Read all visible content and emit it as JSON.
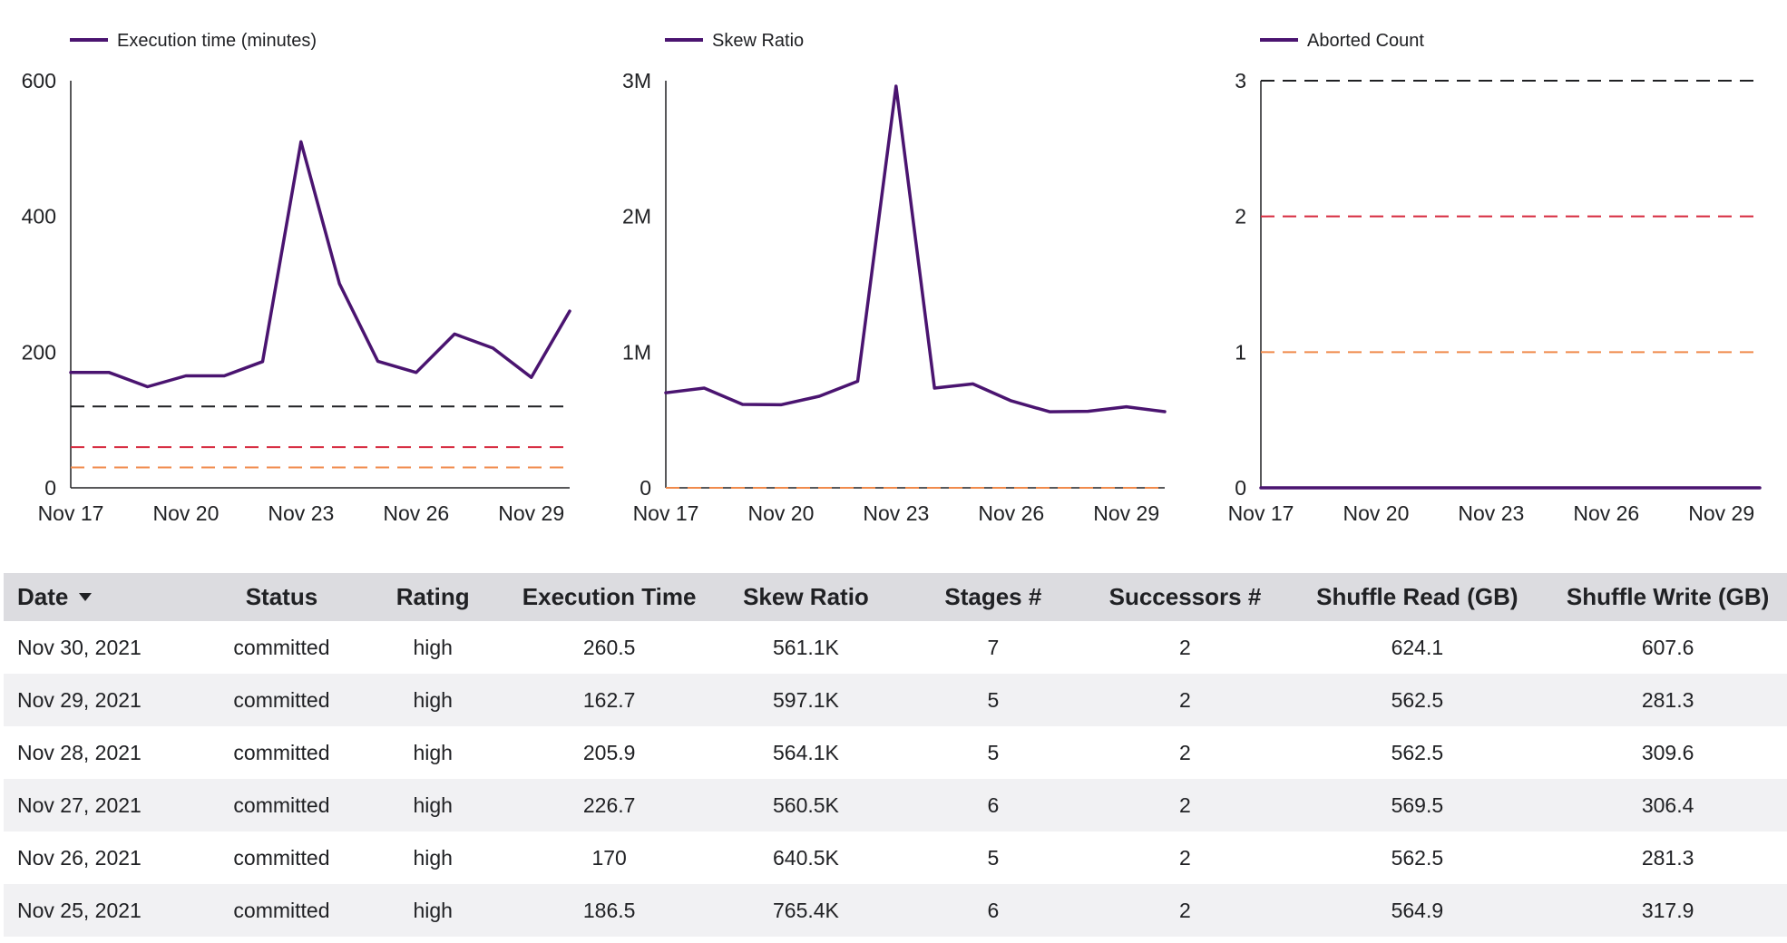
{
  "colors": {
    "series": "#4a1470",
    "line_black": "#202124",
    "line_red": "#d6293e",
    "line_orange": "#f08a4b",
    "axis": "#202124",
    "header_bg": "#dcdce0",
    "row_alt_bg": "#f1f1f3"
  },
  "chart_data": [
    {
      "type": "line",
      "legend": "Execution time (minutes)",
      "x": [
        "Nov 17",
        "Nov 18",
        "Nov 19",
        "Nov 20",
        "Nov 21",
        "Nov 22",
        "Nov 23",
        "Nov 24",
        "Nov 25",
        "Nov 26",
        "Nov 27",
        "Nov 28",
        "Nov 29",
        "Nov 30"
      ],
      "x_tick_labels": [
        "Nov 17",
        "Nov 20",
        "Nov 23",
        "Nov 26",
        "Nov 29"
      ],
      "series": [
        {
          "name": "Execution time (minutes)",
          "values": [
            170,
            170,
            149,
            165,
            165,
            186,
            510,
            301,
            186.5,
            170,
            226.7,
            205.9,
            162.7,
            260.5
          ]
        }
      ],
      "reference_lines": [
        {
          "value": 120,
          "color": "black",
          "style": "dashed"
        },
        {
          "value": 60,
          "color": "red",
          "style": "dashed"
        },
        {
          "value": 30,
          "color": "orange",
          "style": "dashed"
        }
      ],
      "y_ticks": [
        "0",
        "200",
        "400",
        "600"
      ],
      "ylim": [
        0,
        600
      ],
      "legend_position": "top-left"
    },
    {
      "type": "line",
      "legend": "Skew Ratio",
      "x": [
        "Nov 17",
        "Nov 18",
        "Nov 19",
        "Nov 20",
        "Nov 21",
        "Nov 22",
        "Nov 23",
        "Nov 24",
        "Nov 25",
        "Nov 26",
        "Nov 27",
        "Nov 28",
        "Nov 29",
        "Nov 30"
      ],
      "x_tick_labels": [
        "Nov 17",
        "Nov 20",
        "Nov 23",
        "Nov 26",
        "Nov 29"
      ],
      "series": [
        {
          "name": "Skew Ratio",
          "values": [
            700000,
            735000,
            615000,
            612000,
            675000,
            785000,
            2960000,
            735000,
            765400,
            640500,
            560500,
            564100,
            597100,
            561100
          ]
        }
      ],
      "reference_lines": [
        {
          "value": 0,
          "color": "orange",
          "style": "dashed"
        }
      ],
      "y_ticks": [
        "0",
        "1M",
        "2M",
        "3M"
      ],
      "ylim": [
        0,
        3000000
      ],
      "legend_position": "top-left"
    },
    {
      "type": "line",
      "legend": "Aborted Count",
      "x": [
        "Nov 17",
        "Nov 18",
        "Nov 19",
        "Nov 20",
        "Nov 21",
        "Nov 22",
        "Nov 23",
        "Nov 24",
        "Nov 25",
        "Nov 26",
        "Nov 27",
        "Nov 28",
        "Nov 29",
        "Nov 30"
      ],
      "x_tick_labels": [
        "Nov 17",
        "Nov 20",
        "Nov 23",
        "Nov 26",
        "Nov 29"
      ],
      "series": [
        {
          "name": "Aborted Count",
          "values": [
            0,
            0,
            0,
            0,
            0,
            0,
            0,
            0,
            0,
            0,
            0,
            0,
            0,
            0
          ]
        }
      ],
      "reference_lines": [
        {
          "value": 3,
          "color": "black",
          "style": "dashed"
        },
        {
          "value": 2,
          "color": "red",
          "style": "dashed"
        },
        {
          "value": 1,
          "color": "orange",
          "style": "dashed"
        }
      ],
      "y_ticks": [
        "0",
        "1",
        "2",
        "3"
      ],
      "ylim": [
        0,
        3
      ],
      "legend_position": "top-left"
    }
  ],
  "table": {
    "headers": [
      "Date",
      "Status",
      "Rating",
      "Execution Time",
      "Skew Ratio",
      "Stages #",
      "Successors #",
      "Shuffle Read (GB)",
      "Shuffle Write (GB)"
    ],
    "sort_icon": "caret-down-icon",
    "rows": [
      [
        "Nov 30, 2021",
        "committed",
        "high",
        "260.5",
        "561.1K",
        "7",
        "2",
        "624.1",
        "607.6"
      ],
      [
        "Nov 29, 2021",
        "committed",
        "high",
        "162.7",
        "597.1K",
        "5",
        "2",
        "562.5",
        "281.3"
      ],
      [
        "Nov 28, 2021",
        "committed",
        "high",
        "205.9",
        "564.1K",
        "5",
        "2",
        "562.5",
        "309.6"
      ],
      [
        "Nov 27, 2021",
        "committed",
        "high",
        "226.7",
        "560.5K",
        "6",
        "2",
        "569.5",
        "306.4"
      ],
      [
        "Nov 26, 2021",
        "committed",
        "high",
        "170",
        "640.5K",
        "5",
        "2",
        "562.5",
        "281.3"
      ],
      [
        "Nov 25, 2021",
        "committed",
        "high",
        "186.5",
        "765.4K",
        "6",
        "2",
        "564.9",
        "317.9"
      ]
    ]
  }
}
